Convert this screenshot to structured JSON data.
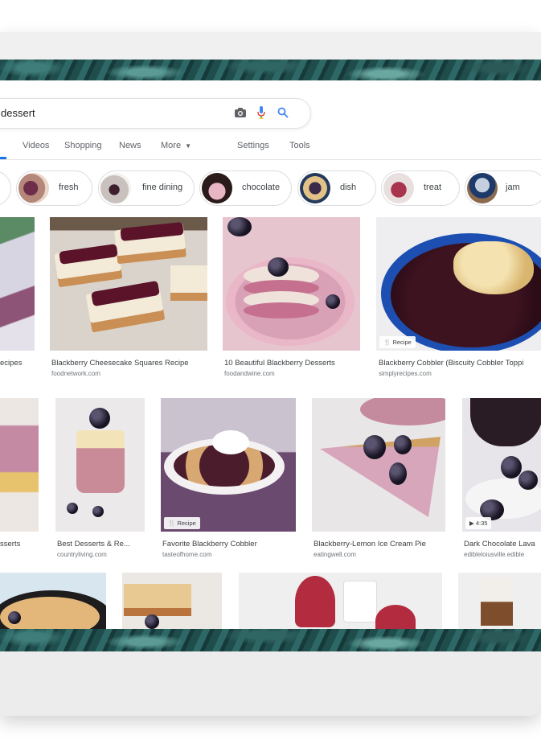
{
  "search": {
    "query": "dessert"
  },
  "tabs": [
    {
      "label": "Videos"
    },
    {
      "label": "Shopping"
    },
    {
      "label": "News"
    },
    {
      "label": "More"
    },
    {
      "label": "Settings"
    },
    {
      "label": "Tools"
    }
  ],
  "chips": [
    {
      "label": "fresh"
    },
    {
      "label": "fine dining"
    },
    {
      "label": "chocolate"
    },
    {
      "label": "dish"
    },
    {
      "label": "treat"
    },
    {
      "label": "jam"
    }
  ],
  "results_row1": [
    {
      "title": "ecipes",
      "source": ""
    },
    {
      "title": "Blackberry Cheesecake Squares Recipe",
      "source": "foodnetwork.com"
    },
    {
      "title": "10 Beautiful Blackberry Desserts",
      "source": "foodandwine.com"
    },
    {
      "title": "Blackberry Cobbler (Biscuity Cobbler Toppi",
      "source": "simplyrecipes.com",
      "badge": "Recipe"
    }
  ],
  "results_row2": [
    {
      "title": "sserts",
      "source": ""
    },
    {
      "title": "Best Desserts & Re...",
      "source": "countryliving.com"
    },
    {
      "title": "Favorite Blackberry Cobbler",
      "source": "tasteofhome.com",
      "badge": "Recipe"
    },
    {
      "title": "Blackberry-Lemon Ice Cream Pie",
      "source": "eatingwell.com"
    },
    {
      "title": "Dark Chocolate Lava",
      "source": "edibleloiusville.edible",
      "badge": "4:35"
    }
  ],
  "colors": {
    "accent": "#1a73e8",
    "frame": "#ebebeb",
    "leaf": "#2d6866"
  },
  "icons": [
    "camera-icon",
    "microphone-icon",
    "search-icon",
    "recipe-icon",
    "play-icon"
  ]
}
